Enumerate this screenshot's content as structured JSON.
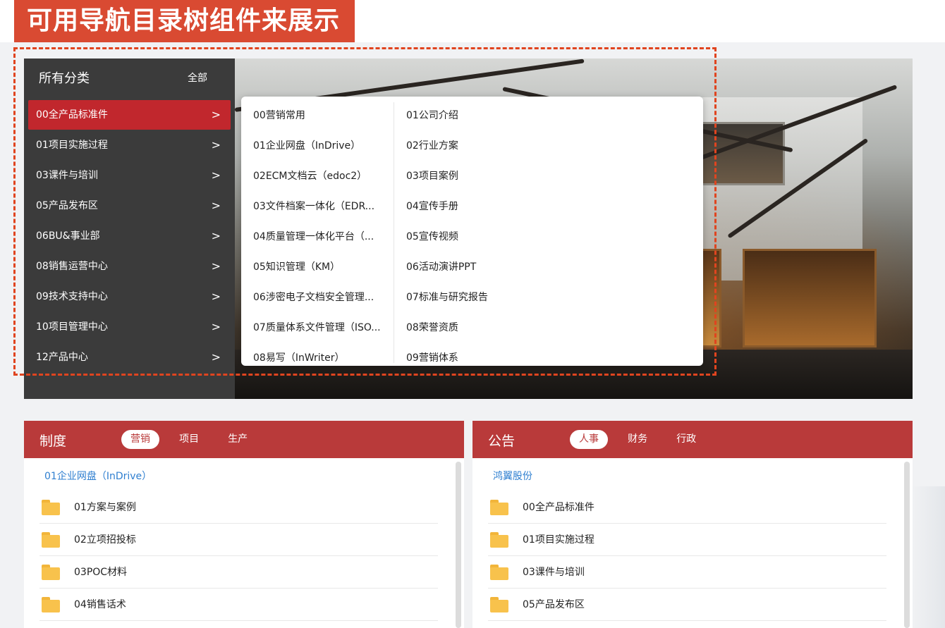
{
  "banner": {
    "label": "可用导航目录树组件来展示"
  },
  "sidebar": {
    "title": "所有分类",
    "all_link": "全部",
    "chevron": ">",
    "items": [
      {
        "label": "00全产品标准件",
        "active": true
      },
      {
        "label": "01项目实施过程"
      },
      {
        "label": "03课件与培训"
      },
      {
        "label": "05产品发布区"
      },
      {
        "label": "06BU&事业部"
      },
      {
        "label": "08销售运营中心"
      },
      {
        "label": "09技术支持中心"
      },
      {
        "label": "10项目管理中心"
      },
      {
        "label": "12产品中心"
      }
    ]
  },
  "dropdown": {
    "col1": [
      "00营销常用",
      "01企业网盘（InDrive）",
      "02ECM文档云（edoc2）",
      "03文件档案一体化（EDR...",
      "04质量管理一体化平台（...",
      "05知识管理（KM）",
      "06涉密电子文档安全管理...",
      "07质量体系文件管理（ISO...",
      "08易写（InWriter）"
    ],
    "col2": [
      "01公司介绍",
      "02行业方案",
      "03项目案例",
      "04宣传手册",
      "05宣传视频",
      "06活动演讲PPT",
      "07标准与研究报告",
      "08荣誉资质",
      "09营销体系"
    ]
  },
  "panel_left": {
    "title": "制度",
    "tabs": [
      "营销",
      "项目",
      "生产"
    ],
    "subtitle": "01企业网盘（InDrive）",
    "files": [
      "01方案与案例",
      "02立项招投标",
      "03POC材料",
      "04销售话术"
    ]
  },
  "panel_right": {
    "title": "公告",
    "tabs": [
      "人事",
      "财务",
      "行政"
    ],
    "subtitle": "鸿翼股份",
    "files": [
      "00全产品标准件",
      "01项目实施过程",
      "03课件与培训",
      "05产品发布区"
    ]
  },
  "colors": {
    "accent_red": "#c1272d",
    "panel_header": "#b93a3a",
    "banner_tag": "#d94a32",
    "highlight_dash": "#e0441f",
    "sidebar_bg": "#3b3b3b",
    "link_blue": "#2f7fd0",
    "folder_yellow": "#f8c24c"
  },
  "icons": {
    "folder": "folder-icon",
    "chevron": "chevron-right-icon"
  }
}
